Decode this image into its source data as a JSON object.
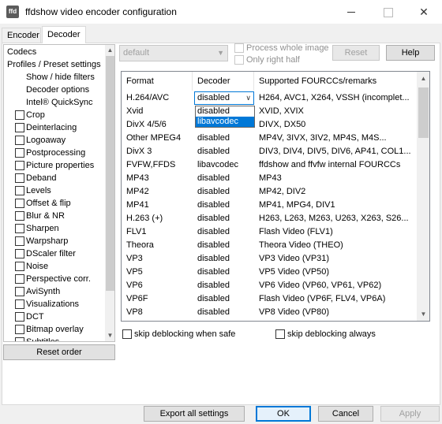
{
  "window": {
    "title": "ffdshow video encoder configuration",
    "icon_text": "ffd"
  },
  "tabs": [
    {
      "label": "Encoder",
      "active": false
    },
    {
      "label": "Decoder",
      "active": true
    }
  ],
  "sidebar": {
    "plain_items": [
      {
        "label": "Codecs"
      },
      {
        "label": "Profiles / Preset settings"
      },
      {
        "label": "Show / hide filters"
      },
      {
        "label": "Decoder options"
      },
      {
        "label": "Intel® QuickSync"
      }
    ],
    "filters": [
      {
        "label": "Crop",
        "checked": false
      },
      {
        "label": "Deinterlacing",
        "checked": false
      },
      {
        "label": "Logoaway",
        "checked": false
      },
      {
        "label": "Postprocessing",
        "checked": false
      },
      {
        "label": "Picture properties",
        "checked": false
      },
      {
        "label": "Deband",
        "checked": false
      },
      {
        "label": "Levels",
        "checked": false
      },
      {
        "label": "Offset & flip",
        "checked": false
      },
      {
        "label": "Blur & NR",
        "checked": false
      },
      {
        "label": "Sharpen",
        "checked": false
      },
      {
        "label": "Warpsharp",
        "checked": false
      },
      {
        "label": "DScaler filter",
        "checked": false
      },
      {
        "label": "Noise",
        "checked": false
      },
      {
        "label": "Perspective corr.",
        "checked": false
      },
      {
        "label": "AviSynth",
        "checked": false
      },
      {
        "label": "Visualizations",
        "checked": false
      },
      {
        "label": "DCT",
        "checked": false
      },
      {
        "label": "Bitmap overlay",
        "checked": false
      },
      {
        "label": "Subtitles",
        "checked": false
      }
    ],
    "reset_order_label": "Reset order"
  },
  "toolbar": {
    "preset_value": "default",
    "process_whole_image": "Process whole image",
    "only_right_half": "Only right half",
    "reset_label": "Reset",
    "help_label": "Help"
  },
  "codec_table": {
    "columns": [
      "Format",
      "Decoder",
      "Supported FOURCCs/remarks"
    ],
    "rows": [
      {
        "format": "H.264/AVC",
        "decoder": "disabled",
        "remarks": "H264, AVC1, X264, VSSH (incomplet..."
      },
      {
        "format": "Xvid",
        "decoder": "disabled",
        "remarks": "XVID, XVIX"
      },
      {
        "format": "DivX 4/5/6",
        "decoder": "disabled",
        "remarks": "DIVX, DX50"
      },
      {
        "format": "Other MPEG4",
        "decoder": "disabled",
        "remarks": "MP4V, 3IVX, 3IV2, MP4S, M4S..."
      },
      {
        "format": "DivX 3",
        "decoder": "disabled",
        "remarks": "DIV3, DIV4, DIV5, DIV6, AP41, COL1..."
      },
      {
        "format": "FVFW,FFDS",
        "decoder": "libavcodec",
        "remarks": "ffdshow and ffvfw internal FOURCCs"
      },
      {
        "format": "MP43",
        "decoder": "disabled",
        "remarks": "MP43"
      },
      {
        "format": "MP42",
        "decoder": "disabled",
        "remarks": "MP42, DIV2"
      },
      {
        "format": "MP41",
        "decoder": "disabled",
        "remarks": "MP41, MPG4, DIV1"
      },
      {
        "format": "H.263 (+)",
        "decoder": "disabled",
        "remarks": "H263, L263, M263, U263, X263, S26..."
      },
      {
        "format": "FLV1",
        "decoder": "disabled",
        "remarks": "Flash Video (FLV1)"
      },
      {
        "format": "Theora",
        "decoder": "disabled",
        "remarks": "Theora Video (THEO)"
      },
      {
        "format": "VP3",
        "decoder": "disabled",
        "remarks": "VP3 Video (VP31)"
      },
      {
        "format": "VP5",
        "decoder": "disabled",
        "remarks": "VP5 Video (VP50)"
      },
      {
        "format": "VP6",
        "decoder": "disabled",
        "remarks": "VP6 Video (VP60, VP61, VP62)"
      },
      {
        "format": "VP6F",
        "decoder": "disabled",
        "remarks": "Flash Video (VP6F, FLV4, VP6A)"
      },
      {
        "format": "VP8",
        "decoder": "disabled",
        "remarks": "VP8 Video (VP80)"
      }
    ],
    "dropdown_options": [
      "disabled",
      "libavcodec"
    ],
    "dropdown_highlighted": "libavcodec"
  },
  "options": {
    "skip_deblocking_safe": "skip deblocking when safe",
    "skip_deblocking_always": "skip deblocking always"
  },
  "footer": {
    "export_label": "Export all settings",
    "ok_label": "OK",
    "cancel_label": "Cancel",
    "apply_label": "Apply"
  },
  "colors": {
    "accent": "#0078d7",
    "window_bg": "#f0f0f0"
  }
}
